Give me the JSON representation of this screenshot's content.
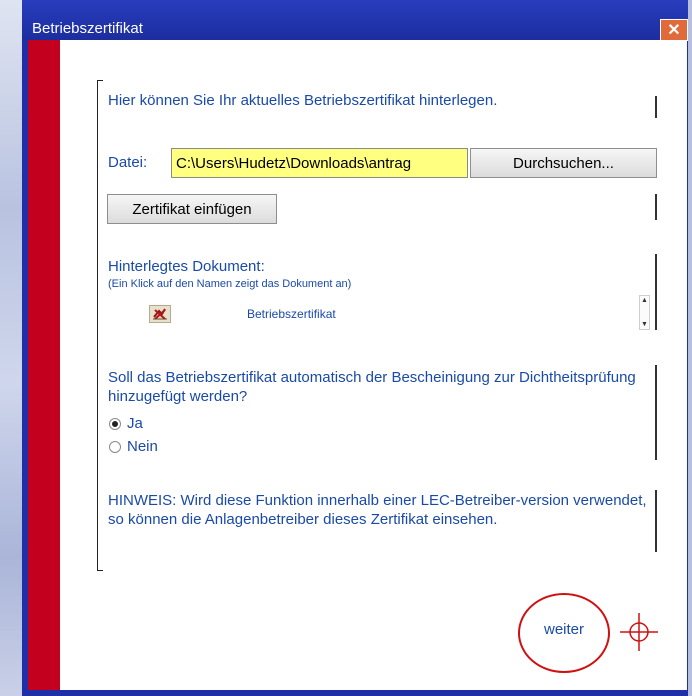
{
  "window": {
    "title": "Betriebszertifikat",
    "close_glyph": "✕"
  },
  "intro_text": "Hier können Sie Ihr aktuelles Betriebszertifikat hinterlegen.",
  "file": {
    "label": "Datei:",
    "value": "C:\\Users\\Hudetz\\Downloads\\antrag",
    "browse_label": "Durchsuchen..."
  },
  "insert_button_label": "Zertifikat einfügen",
  "document": {
    "heading": "Hinterlegtes Dokument:",
    "hint": "(Ein Klick auf den Namen zeigt das Dokument an)",
    "name": "Betriebszertifikat",
    "delete_icon": "delete-document-icon"
  },
  "question": {
    "text": "Soll das Betriebszertifikat automatisch der Bescheinigung zur Dichtheitsprüfung hinzugefügt werden?",
    "options": [
      {
        "label": "Ja",
        "checked": true
      },
      {
        "label": "Nein",
        "checked": false
      }
    ]
  },
  "note": "HINWEIS: Wird diese Funktion innerhalb einer LEC-Betreiber-version verwendet, so können die Anlagenbetreiber dieses Zertifikat einsehen.",
  "weiter_label": "weiter",
  "colors": {
    "accent_red": "#c3001d",
    "text_blue": "#1a4aa8",
    "titlebar_blue": "#1f2fa8",
    "input_yellow": "#ffff80",
    "annotation_red": "#d01010"
  }
}
